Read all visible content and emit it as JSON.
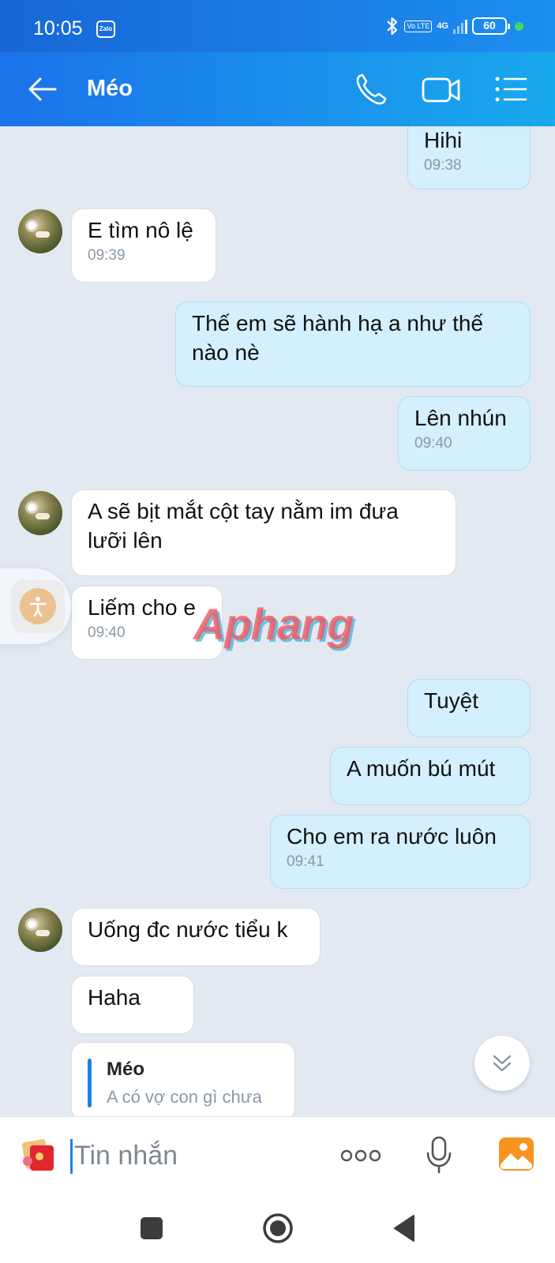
{
  "status_bar": {
    "time": "10:05",
    "app_badge": "Zalo",
    "volte": "Vo LTE",
    "network": "4G",
    "battery": "60"
  },
  "header": {
    "contact_name": "Méo"
  },
  "messages": [
    {
      "direction": "out",
      "text": "Hihi",
      "time": "09:38"
    },
    {
      "direction": "in",
      "text": "E tìm nô lệ",
      "time": "09:39"
    },
    {
      "direction": "out",
      "text": "Thế em sẽ hành hạ a như thế nào nè"
    },
    {
      "direction": "out",
      "text": "Lên nhún",
      "time": "09:40"
    },
    {
      "direction": "in",
      "text": "A sẽ bịt mắt cột tay nằm im đưa lưỡi lên"
    },
    {
      "direction": "in",
      "text": "Liếm cho e",
      "time": "09:40"
    },
    {
      "direction": "out",
      "text": "Tuyệt"
    },
    {
      "direction": "out",
      "text": "A muốn bú mút"
    },
    {
      "direction": "out",
      "text": "Cho em ra nước luôn",
      "time": "09:41"
    },
    {
      "direction": "in",
      "text": "Uống đc nước tiểu k"
    },
    {
      "direction": "in",
      "text": "Haha"
    }
  ],
  "quote": {
    "name": "Méo",
    "text": "A có vợ con gì chưa"
  },
  "watermark": "Aphang",
  "input": {
    "placeholder": "Tin nhắn"
  },
  "icons": {
    "back": "arrow-left-icon",
    "call": "phone-icon",
    "video": "video-camera-icon",
    "menu": "list-menu-icon",
    "scroll": "chevron-double-down-icon",
    "sticker": "sticker-icon",
    "more": "more-dots-icon",
    "mic": "microphone-icon",
    "image": "image-icon",
    "accessibility": "accessibility-icon"
  },
  "colors": {
    "header": "#1b72ea",
    "outgoing_bubble": "#d4effd",
    "incoming_bubble": "#ffffff",
    "chat_background": "#e2e9f1",
    "accent": "#1f82e8"
  }
}
